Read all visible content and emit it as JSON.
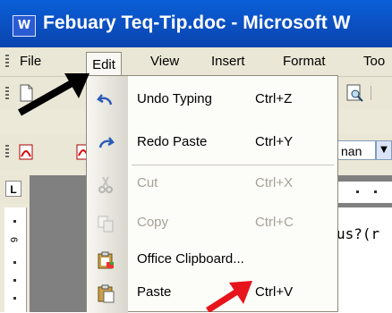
{
  "window": {
    "title": "Febuary Teq-Tip.doc - Microsoft W",
    "app_icon": "word-doc-icon"
  },
  "menubar": {
    "items": [
      "File",
      "Edit",
      "View",
      "Insert",
      "Format",
      "Too"
    ],
    "active": "Edit"
  },
  "toolbar": {
    "font_value": "nan"
  },
  "ruler": {
    "tab_stop_label": "L",
    "number": "6"
  },
  "document": {
    "visible_text": "us?(r"
  },
  "edit_menu": {
    "items": [
      {
        "label": "Undo Typing",
        "shortcut": "Ctrl+Z",
        "icon": "undo-icon",
        "enabled": true
      },
      {
        "label": "Redo Paste",
        "shortcut": "Ctrl+Y",
        "icon": "redo-icon",
        "enabled": true
      },
      {
        "label": "Cut",
        "shortcut": "Ctrl+X",
        "icon": "scissors-icon",
        "enabled": false
      },
      {
        "label": "Copy",
        "shortcut": "Ctrl+C",
        "icon": "copy-icon",
        "enabled": false
      },
      {
        "label": "Office Clipboard...",
        "shortcut": "",
        "icon": "office-clipboard-icon",
        "enabled": true
      },
      {
        "label": "Paste",
        "shortcut": "Ctrl+V",
        "icon": "paste-icon",
        "enabled": true
      }
    ]
  },
  "annotations": {
    "black_arrow_color": "#000000",
    "red_arrow_color": "#e8141b"
  }
}
